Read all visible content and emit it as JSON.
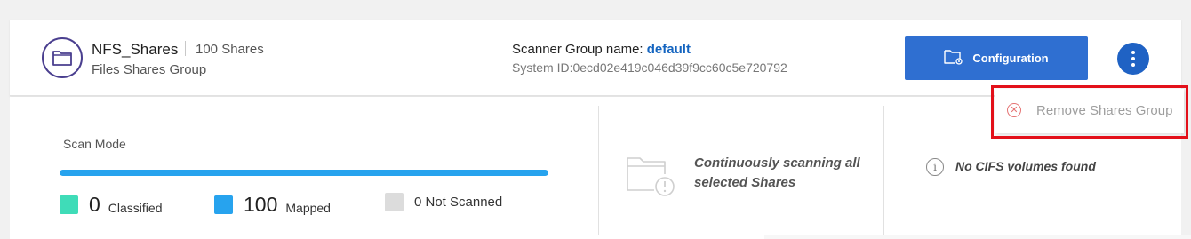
{
  "header": {
    "group_name": "NFS_Shares",
    "share_count": "100 Shares",
    "subtitle": "Files Shares Group",
    "icon": "folder-icon",
    "scanner_label": "Scanner Group name:",
    "scanner_value": "default",
    "system_id": "System ID:0ecd02e419c046d39f9cc60c5e720792",
    "config_button": "Configuration",
    "config_icon": "folder-gear-icon",
    "menu_icon": "kebab-menu-icon"
  },
  "scan": {
    "mode_label": "Scan Mode",
    "progress_fraction": 1.0,
    "legend": [
      {
        "count": "0",
        "label": "Classified",
        "color": "#3fdcb8"
      },
      {
        "count": "100",
        "label": "Mapped",
        "color": "#27a3ee"
      },
      {
        "text": "0 Not Scanned",
        "color": "#dcdcdc"
      }
    ]
  },
  "status": {
    "scan_message": "Continuously scanning all selected Shares",
    "cifs_message": "No CIFS volumes found"
  },
  "menu": {
    "remove_label": "Remove Shares Group",
    "remove_icon": "close-circle-icon"
  },
  "colors": {
    "accent": "#2f6fd1",
    "highlight": "#e3101a",
    "progress": "#27a3ee"
  }
}
